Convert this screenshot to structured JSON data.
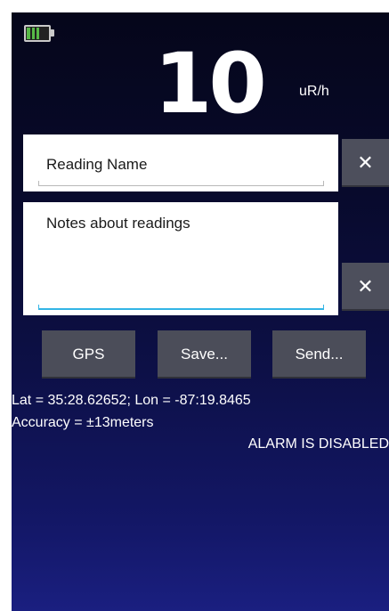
{
  "status": {
    "battery_icon": "battery-icon",
    "battery_color": "#57b947"
  },
  "reading": {
    "value": "10",
    "unit": "uR/h"
  },
  "inputs": {
    "reading_name": "Reading Name",
    "notes": "Notes about readings",
    "clear_icon": "close-icon",
    "clear_label": "✕"
  },
  "buttons": {
    "gps": "GPS",
    "save": "Save...",
    "send": "Send..."
  },
  "location": {
    "latlon": "Lat = 35:28.62652; Lon = -87:19.8465",
    "accuracy": "Accuracy = ±13meters"
  },
  "alarm": {
    "status": "ALARM IS DISABLED"
  },
  "colors": {
    "accent": "#33b5e5",
    "button_bg": "#4b4d59",
    "background_top": "#05061a",
    "background_bottom": "#1a1f80"
  }
}
